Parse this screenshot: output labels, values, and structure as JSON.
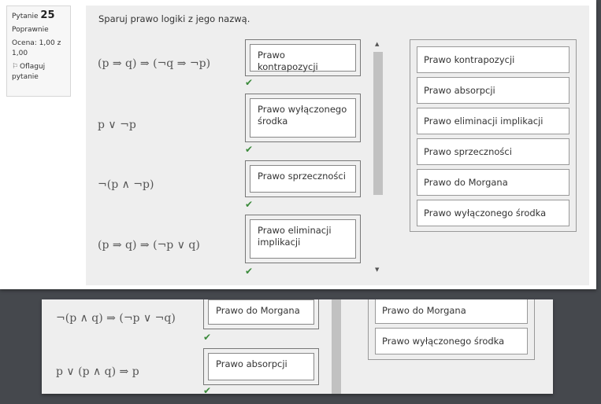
{
  "question": {
    "label": "Pytanie",
    "number": "25",
    "status": "Poprawnie",
    "grade": "Ocena: 1,00 z 1,00",
    "flag_label": "Oflaguj pytanie",
    "prompt": "Sparuj prawo logiki z jego nazwą."
  },
  "pairs": [
    {
      "stem": "(p ⇒ q) ⇒ (¬q ⇒ ¬p)",
      "answer": "Prawo kontrapozycji",
      "correct": "✔"
    },
    {
      "stem": "p ∨ ¬p",
      "answer": "Prawo wyłączonego środka",
      "correct": "✔"
    },
    {
      "stem": "¬(p ∧ ¬p)",
      "answer": "Prawo sprzeczności",
      "correct": "✔"
    },
    {
      "stem": "(p ⇒ q) ⇒ (¬p ∨ q)",
      "answer": "Prawo eliminacji implikacji",
      "correct": "✔"
    },
    {
      "stem": "¬(p ∧ q) ⇒ (¬p ∨ ¬q)",
      "answer": "Prawo do Morgana",
      "correct": "✔"
    },
    {
      "stem": "p ∨ (p ∧ q) ⇒ p",
      "answer": "Prawo absorpcji",
      "correct": "✔"
    }
  ],
  "choices": [
    "Prawo kontrapozycji",
    "Prawo absorpcji",
    "Prawo eliminacji implikacji",
    "Prawo sprzeczności",
    "Prawo do Morgana",
    "Prawo wyłączonego środka"
  ],
  "colors": {
    "check": "#3b8a3b",
    "background": "#45484d",
    "panel": "#eeeeee"
  }
}
